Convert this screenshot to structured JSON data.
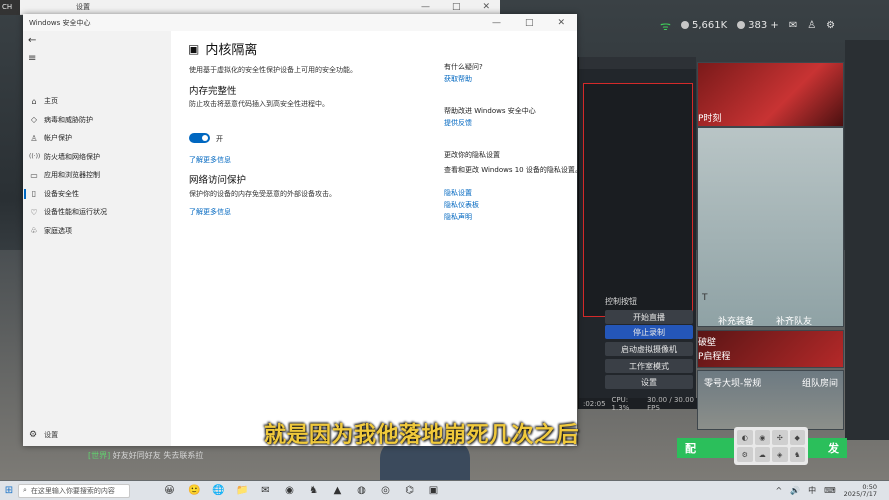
{
  "browser": {
    "left_label": "CH",
    "tab_title": "设置",
    "controls": [
      "—",
      "□",
      "✕"
    ]
  },
  "window": {
    "title": "Windows 安全中心",
    "controls": [
      "—",
      "□",
      "✕"
    ]
  },
  "sidebar": {
    "back_icon": "←",
    "menu_icon": "≡",
    "items": [
      {
        "icon": "⌂",
        "label": "主页"
      },
      {
        "icon": "◇",
        "label": "病毒和威胁防护"
      },
      {
        "icon": "♙",
        "label": "帐户保护"
      },
      {
        "icon": "((·))",
        "label": "防火墙和网络保护"
      },
      {
        "icon": "▭",
        "label": "应用和浏览器控制"
      },
      {
        "icon": "▯",
        "label": "设备安全性"
      },
      {
        "icon": "♡",
        "label": "设备性能和运行状况"
      },
      {
        "icon": "♧",
        "label": "家庭选项"
      }
    ],
    "selected_index": 5,
    "settings": {
      "icon": "⚙",
      "label": "设置"
    }
  },
  "main": {
    "title": "内核隔离",
    "description": "使用基于虚拟化的安全性保护设备上可用的安全功能。",
    "memory_integrity": {
      "title": "内存完整性",
      "description": "防止攻击将恶意代码插入到高安全性进程中。",
      "toggle_state": "开",
      "learn_more": "了解更多信息"
    },
    "network_protection": {
      "title": "网络访问保护",
      "description": "保护你的设备的内存免受恶意的外部设备攻击。",
      "learn_more": "了解更多信息"
    }
  },
  "right_panel": {
    "question_title": "有什么疑问?",
    "question_link": "获取帮助",
    "improve_title": "帮助改进 Windows 安全中心",
    "improve_link": "提供反馈",
    "privacy_title": "更改你的隐私设置",
    "privacy_desc": "查看和更改 Windows 10 设备的隐私设置。",
    "privacy_links": [
      "隐私设置",
      "隐私仪表板",
      "隐私声明"
    ]
  },
  "obs": {
    "controls_title": "控制按钮",
    "buttons": [
      "开始直播",
      "停止录制",
      "启动虚拟摄像机",
      "工作室模式",
      "设置"
    ],
    "active_index": 1,
    "status": {
      "time": ":02:05",
      "cpu": "CPU: 1.3%",
      "fps": "30.00 / 30.00 FPS"
    }
  },
  "game": {
    "currency_1": "5,661K",
    "currency_2": "383 +",
    "card_label_top": "P时刻",
    "card_label_art": "T",
    "card_footer_left": "补充装备",
    "card_footer_right": "补齐队友",
    "card_label_break": "破壁",
    "card_label_sub": "P启程程",
    "card_label_map": "零号大坝-常规",
    "card_label_queue": "组队房间",
    "green_btn_left": "配",
    "green_btn_right": "发",
    "chat_tag": "[世界]",
    "chat_text": "好友好同好友 失去联系拉"
  },
  "subtitle": "就是因为我他落地崩死几次之后",
  "tray_icons": [
    "◐",
    "◉",
    "✣",
    "◆",
    "⚙",
    "☁",
    "◈",
    "♞"
  ],
  "taskbar": {
    "start_icon": "⊞",
    "search_placeholder": "在这里输入你要搜索的内容",
    "apps": [
      "😀",
      "🙂",
      "🌐",
      "📁",
      "✉",
      "◉",
      "♞",
      "▲",
      "◍",
      "◎",
      "⌬",
      "▣"
    ],
    "tray": [
      "^",
      "🔊",
      "中",
      "⌨"
    ],
    "time": "0:50",
    "date": "2025/7/17"
  }
}
